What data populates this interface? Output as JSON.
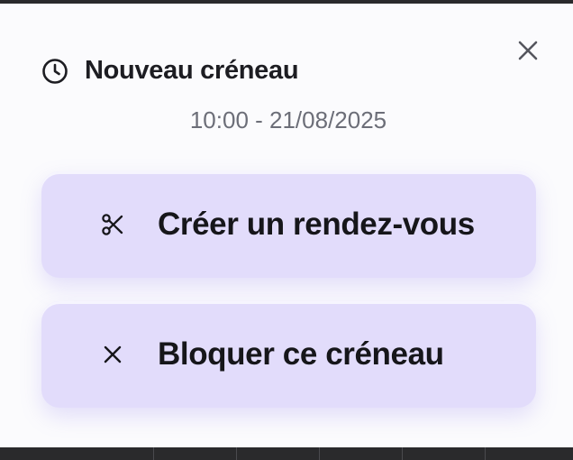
{
  "dialog": {
    "title": "Nouveau créneau",
    "clock_icon": "clock-icon",
    "close_icon": "close-icon",
    "subtitle": "10:00 - 21/08/2025"
  },
  "actions": [
    {
      "label": "Créer un rendez-vous",
      "icon": "scissors-icon"
    },
    {
      "label": "Bloquer ce créneau",
      "icon": "x-icon"
    }
  ],
  "colors": {
    "modal_bg": "#fbfbfd",
    "action_bg": "#e2dcfb",
    "title_text": "#1d1d22",
    "subtitle_text": "#6c6e78"
  }
}
